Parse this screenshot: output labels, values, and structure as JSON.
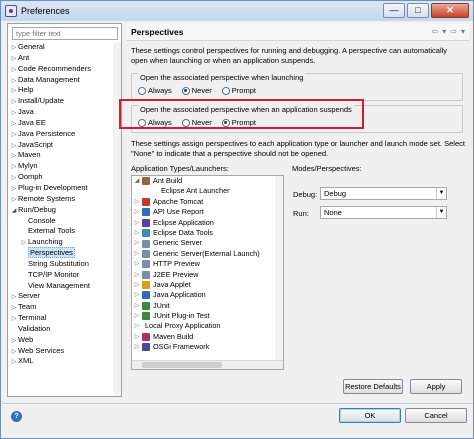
{
  "window": {
    "title": "Preferences",
    "min": "—",
    "max": "□",
    "close": "✕"
  },
  "filter": {
    "placeholder": "type filter text"
  },
  "tree": [
    {
      "label": "General",
      "indent": 0,
      "expand": "▷"
    },
    {
      "label": "Ant",
      "indent": 0,
      "expand": "▷"
    },
    {
      "label": "Code Recommenders",
      "indent": 0,
      "expand": "▷"
    },
    {
      "label": "Data Management",
      "indent": 0,
      "expand": "▷"
    },
    {
      "label": "Help",
      "indent": 0,
      "expand": "▷"
    },
    {
      "label": "Install/Update",
      "indent": 0,
      "expand": "▷"
    },
    {
      "label": "Java",
      "indent": 0,
      "expand": "▷"
    },
    {
      "label": "Java EE",
      "indent": 0,
      "expand": "▷"
    },
    {
      "label": "Java Persistence",
      "indent": 0,
      "expand": "▷"
    },
    {
      "label": "JavaScript",
      "indent": 0,
      "expand": "▷"
    },
    {
      "label": "Maven",
      "indent": 0,
      "expand": "▷"
    },
    {
      "label": "Mylyn",
      "indent": 0,
      "expand": "▷"
    },
    {
      "label": "Oomph",
      "indent": 0,
      "expand": "▷"
    },
    {
      "label": "Plug-in Development",
      "indent": 0,
      "expand": "▷"
    },
    {
      "label": "Remote Systems",
      "indent": 0,
      "expand": "▷"
    },
    {
      "label": "Run/Debug",
      "indent": 0,
      "expand": "◢"
    },
    {
      "label": "Console",
      "indent": 1,
      "expand": ""
    },
    {
      "label": "External Tools",
      "indent": 1,
      "expand": ""
    },
    {
      "label": "Launching",
      "indent": 1,
      "expand": "▷"
    },
    {
      "label": "Perspectives",
      "indent": 1,
      "expand": "",
      "selected": true
    },
    {
      "label": "String Substitution",
      "indent": 1,
      "expand": ""
    },
    {
      "label": "TCP/IP Monitor",
      "indent": 1,
      "expand": ""
    },
    {
      "label": "View Management",
      "indent": 1,
      "expand": ""
    },
    {
      "label": "Server",
      "indent": 0,
      "expand": "▷"
    },
    {
      "label": "Team",
      "indent": 0,
      "expand": "▷"
    },
    {
      "label": "Terminal",
      "indent": 0,
      "expand": "▷"
    },
    {
      "label": "Validation",
      "indent": 0,
      "expand": ""
    },
    {
      "label": "Web",
      "indent": 0,
      "expand": "▷"
    },
    {
      "label": "Web Services",
      "indent": 0,
      "expand": "▷"
    },
    {
      "label": "XML",
      "indent": 0,
      "expand": "▷"
    }
  ],
  "page": {
    "title": "Perspectives",
    "nav_back": "⇦",
    "nav_menu": "▾",
    "nav_fwd": "⇨",
    "nav_more": "▾",
    "desc1": "These settings control perspectives for running and debugging. A perspective can automatically open when launching or when an application suspends.",
    "group_launch": "Open the associated perspective when launching",
    "group_suspend": "Open the associated perspective when an application suspends",
    "opt_always": "Always",
    "opt_never": "Never",
    "opt_prompt": "Prompt",
    "desc2": "These settings assign perspectives to each application type or launcher and launch mode set. Select \"None\" to indicate that a perspective should not be opened.",
    "apps_label": "Application Types/Launchers:",
    "modes_label": "Modes/Perspectives:",
    "debug_label": "Debug:",
    "debug_value": "Debug",
    "run_label": "Run:",
    "run_value": "None"
  },
  "launch_choice": "Never",
  "suspend_choice": "Prompt",
  "apps": [
    {
      "label": "Ant Build",
      "expand": "◢",
      "indent": 0,
      "icon": "#8a6a3a"
    },
    {
      "label": "Eclipse Ant Launcher",
      "expand": "",
      "indent": 1,
      "icon": ""
    },
    {
      "label": "Apache Tomcat",
      "expand": "▷",
      "indent": 0,
      "icon": "#c0392b"
    },
    {
      "label": "API Use Report",
      "expand": "▷",
      "indent": 0,
      "icon": "#2f6db5"
    },
    {
      "label": "Eclipse Application",
      "expand": "▷",
      "indent": 0,
      "icon": "#5a3ea8"
    },
    {
      "label": "Eclipse Data Tools",
      "expand": "▷",
      "indent": 0,
      "icon": "#3a8bbf"
    },
    {
      "label": "Generic Server",
      "expand": "▷",
      "indent": 0,
      "icon": "#7c8ea5"
    },
    {
      "label": "Generic Server(External Launch)",
      "expand": "▷",
      "indent": 0,
      "icon": "#7c8ea5"
    },
    {
      "label": "HTTP Preview",
      "expand": "▷",
      "indent": 0,
      "icon": "#7c8ea5"
    },
    {
      "label": "J2EE Preview",
      "expand": "▷",
      "indent": 0,
      "icon": "#7c8ea5"
    },
    {
      "label": "Java Applet",
      "expand": "▷",
      "indent": 0,
      "icon": "#d4a017"
    },
    {
      "label": "Java Application",
      "expand": "▷",
      "indent": 0,
      "icon": "#2f6db5"
    },
    {
      "label": "JUnit",
      "expand": "▷",
      "indent": 0,
      "icon": "#3b8a3b"
    },
    {
      "label": "JUnit Plug-in Test",
      "expand": "▷",
      "indent": 0,
      "icon": "#3b8a3b"
    },
    {
      "label": "Local Proxy Application",
      "expand": "▷",
      "indent": 0,
      "icon": ""
    },
    {
      "label": "Maven Build",
      "expand": "▷",
      "indent": 0,
      "icon": "#b03060"
    },
    {
      "label": "OSGi Framework",
      "expand": "▷",
      "indent": 0,
      "icon": "#4a4a9a"
    }
  ],
  "buttons": {
    "restore": "Restore Defaults",
    "apply": "Apply",
    "ok": "OK",
    "cancel": "Cancel",
    "help": "?"
  }
}
